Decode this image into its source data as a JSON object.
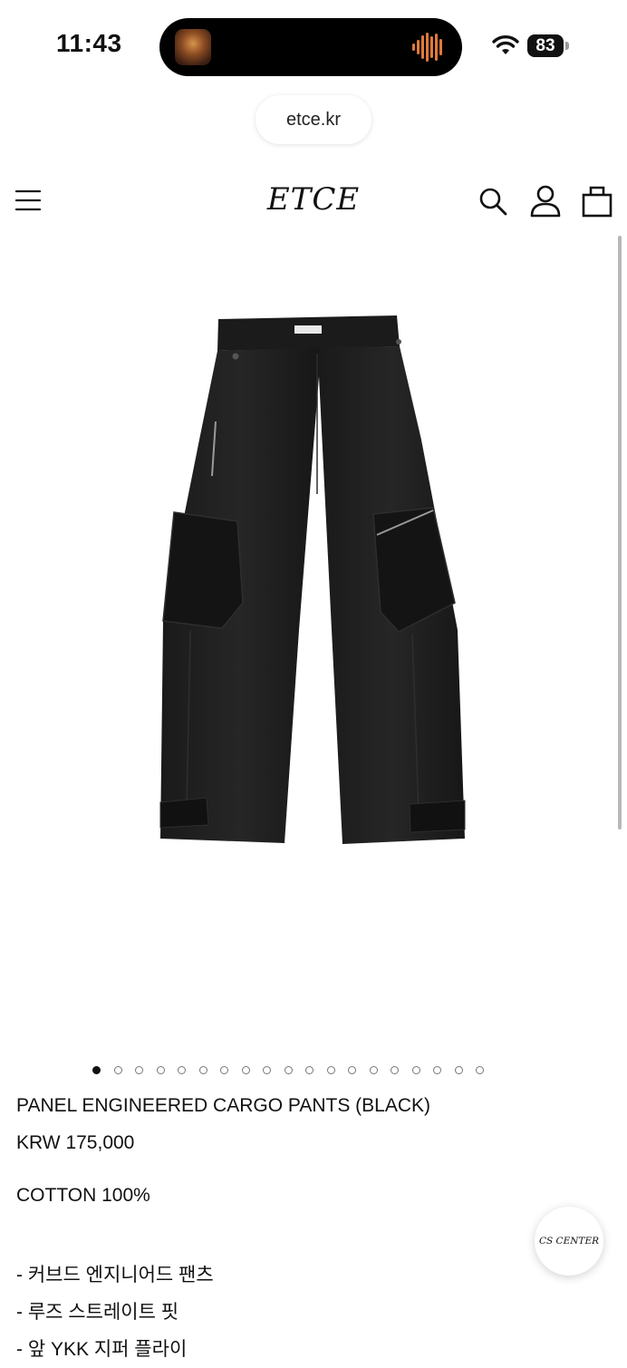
{
  "status_bar": {
    "time": "11:43",
    "battery": "83",
    "icons": [
      "album-art",
      "waveform-icon",
      "wifi-icon",
      "battery-icon"
    ],
    "waveform_color": "#e07a3c"
  },
  "browser": {
    "url": "etce.kr"
  },
  "header": {
    "logo": "ETCE",
    "icons": [
      "menu-icon",
      "search-icon",
      "user-icon",
      "shopping-bag-icon"
    ]
  },
  "gallery": {
    "image_alt": "black panel engineered cargo pants",
    "total_images": 19,
    "active_index": 0
  },
  "product": {
    "name": "PANEL ENGINEERED CARGO PANTS (BLACK)",
    "price": "KRW 175,000",
    "material": "COTTON 100%",
    "features": [
      "- 커브드 엔지니어드 팬츠",
      "- 루즈 스트레이트 핏",
      "- 앞 YKK 지퍼 플라이"
    ]
  },
  "cs_button": {
    "label": "CS CENTER"
  }
}
